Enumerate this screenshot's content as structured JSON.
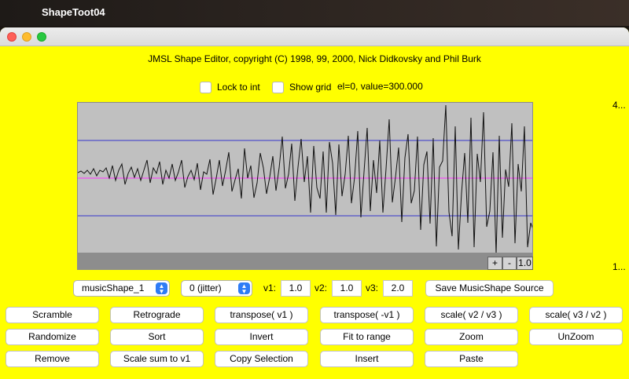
{
  "menubar": {
    "app_name": "ShapeToot04"
  },
  "window": {
    "copyright": "JMSL Shape Editor, copyright (C) 1998, 99, 2000, Nick Didkovsky and Phil Burk",
    "lock_label": "Lock to int",
    "grid_label": "Show grid",
    "status": "el=0, value=300.000",
    "range_top": "4...",
    "range_bottom": "1...",
    "zoom": {
      "plus": "+",
      "minus": "-",
      "value": "1.0"
    },
    "shape_select": "musicShape_1",
    "jitter_select": "0 (jitter)",
    "v1_label": "v1:",
    "v1_value": "1.0",
    "v2_label": "v2:",
    "v2_value": "1.0",
    "v3_label": "v3:",
    "v3_value": "2.0",
    "save_label": "Save MusicShape Source",
    "buttons": [
      [
        "Scramble",
        "Retrograde",
        "transpose( v1 )",
        "transpose( -v1 )",
        "scale( v2 / v3 )",
        "scale( v3 / v2 )"
      ],
      [
        "Randomize",
        "Sort",
        "Invert",
        "Fit to range",
        "Zoom",
        "UnZoom"
      ],
      [
        "Remove",
        "Scale sum to v1",
        "Copy Selection",
        "Insert",
        "Paste"
      ]
    ]
  },
  "colors": {
    "background": "#ffff00",
    "graph_bg": "#c0c0c0",
    "guide_lines": "#3333cc",
    "center_line": "#ff33ff",
    "waveform": "#111111",
    "accent": "#2f7cf6"
  }
}
